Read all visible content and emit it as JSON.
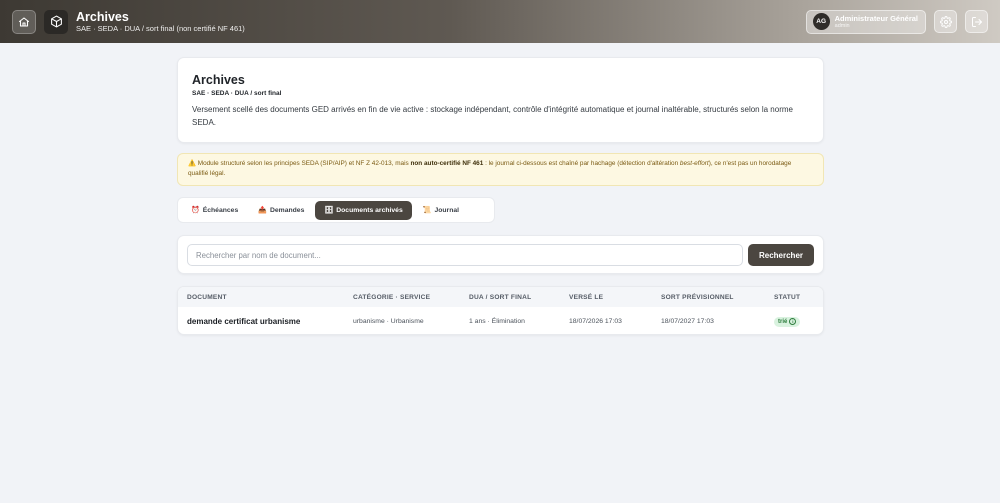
{
  "header": {
    "title": "Archives",
    "subtitle": "SAE · SEDA · DUA / sort final (non certifié NF 461)",
    "user": {
      "initials": "AG",
      "name": "Administrateur Général",
      "role": "admin"
    }
  },
  "intro": {
    "title": "Archives",
    "subtitle": "SAE · SEDA · DUA / sort final",
    "description": "Versement scellé des documents GED arrivés en fin de vie active : stockage indépendant, contrôle d'intégrité automatique et journal inaltérable, structurés selon la norme SEDA."
  },
  "warning": {
    "icon": "⚠️",
    "part1": " Module structuré selon les principes SEDA (SIP/AIP) et NF Z 42-013, mais ",
    "bold": "non auto-certifié NF 461",
    "part2": " : le journal ci-dessous est chaîné par hachage (détection d'altération ",
    "italic": "best-effort",
    "part3": "), ce n'est pas un horodatage qualifié légal."
  },
  "tabs": [
    {
      "icon": "⏰",
      "label": "Échéances",
      "active": false
    },
    {
      "icon": "📤",
      "label": "Demandes",
      "active": false
    },
    {
      "icon": "🗄",
      "label": "Documents archivés",
      "active": true
    },
    {
      "icon": "📜",
      "label": "Journal",
      "active": false
    }
  ],
  "search": {
    "placeholder": "Rechercher par nom de document...",
    "value": "",
    "button": "Rechercher"
  },
  "table": {
    "columns": [
      "DOCUMENT",
      "CATÉGORIE · SERVICE",
      "DUA / SORT FINAL",
      "VERSÉ LE",
      "SORT PRÉVISIONNEL",
      "STATUT"
    ],
    "rows": [
      {
        "document": "demande certificat urbanisme",
        "categorie": "urbanisme · Urbanisme",
        "dua": "1 ans · Élimination",
        "verse": "18/07/2026 17:03",
        "sort": "18/07/2027 17:03",
        "statut": "trié",
        "statut_icon": "i"
      }
    ]
  },
  "colors": {
    "accent": "#4b4640",
    "warning_bg": "#fdf8e2",
    "status_ok": "#2e7d3e"
  }
}
